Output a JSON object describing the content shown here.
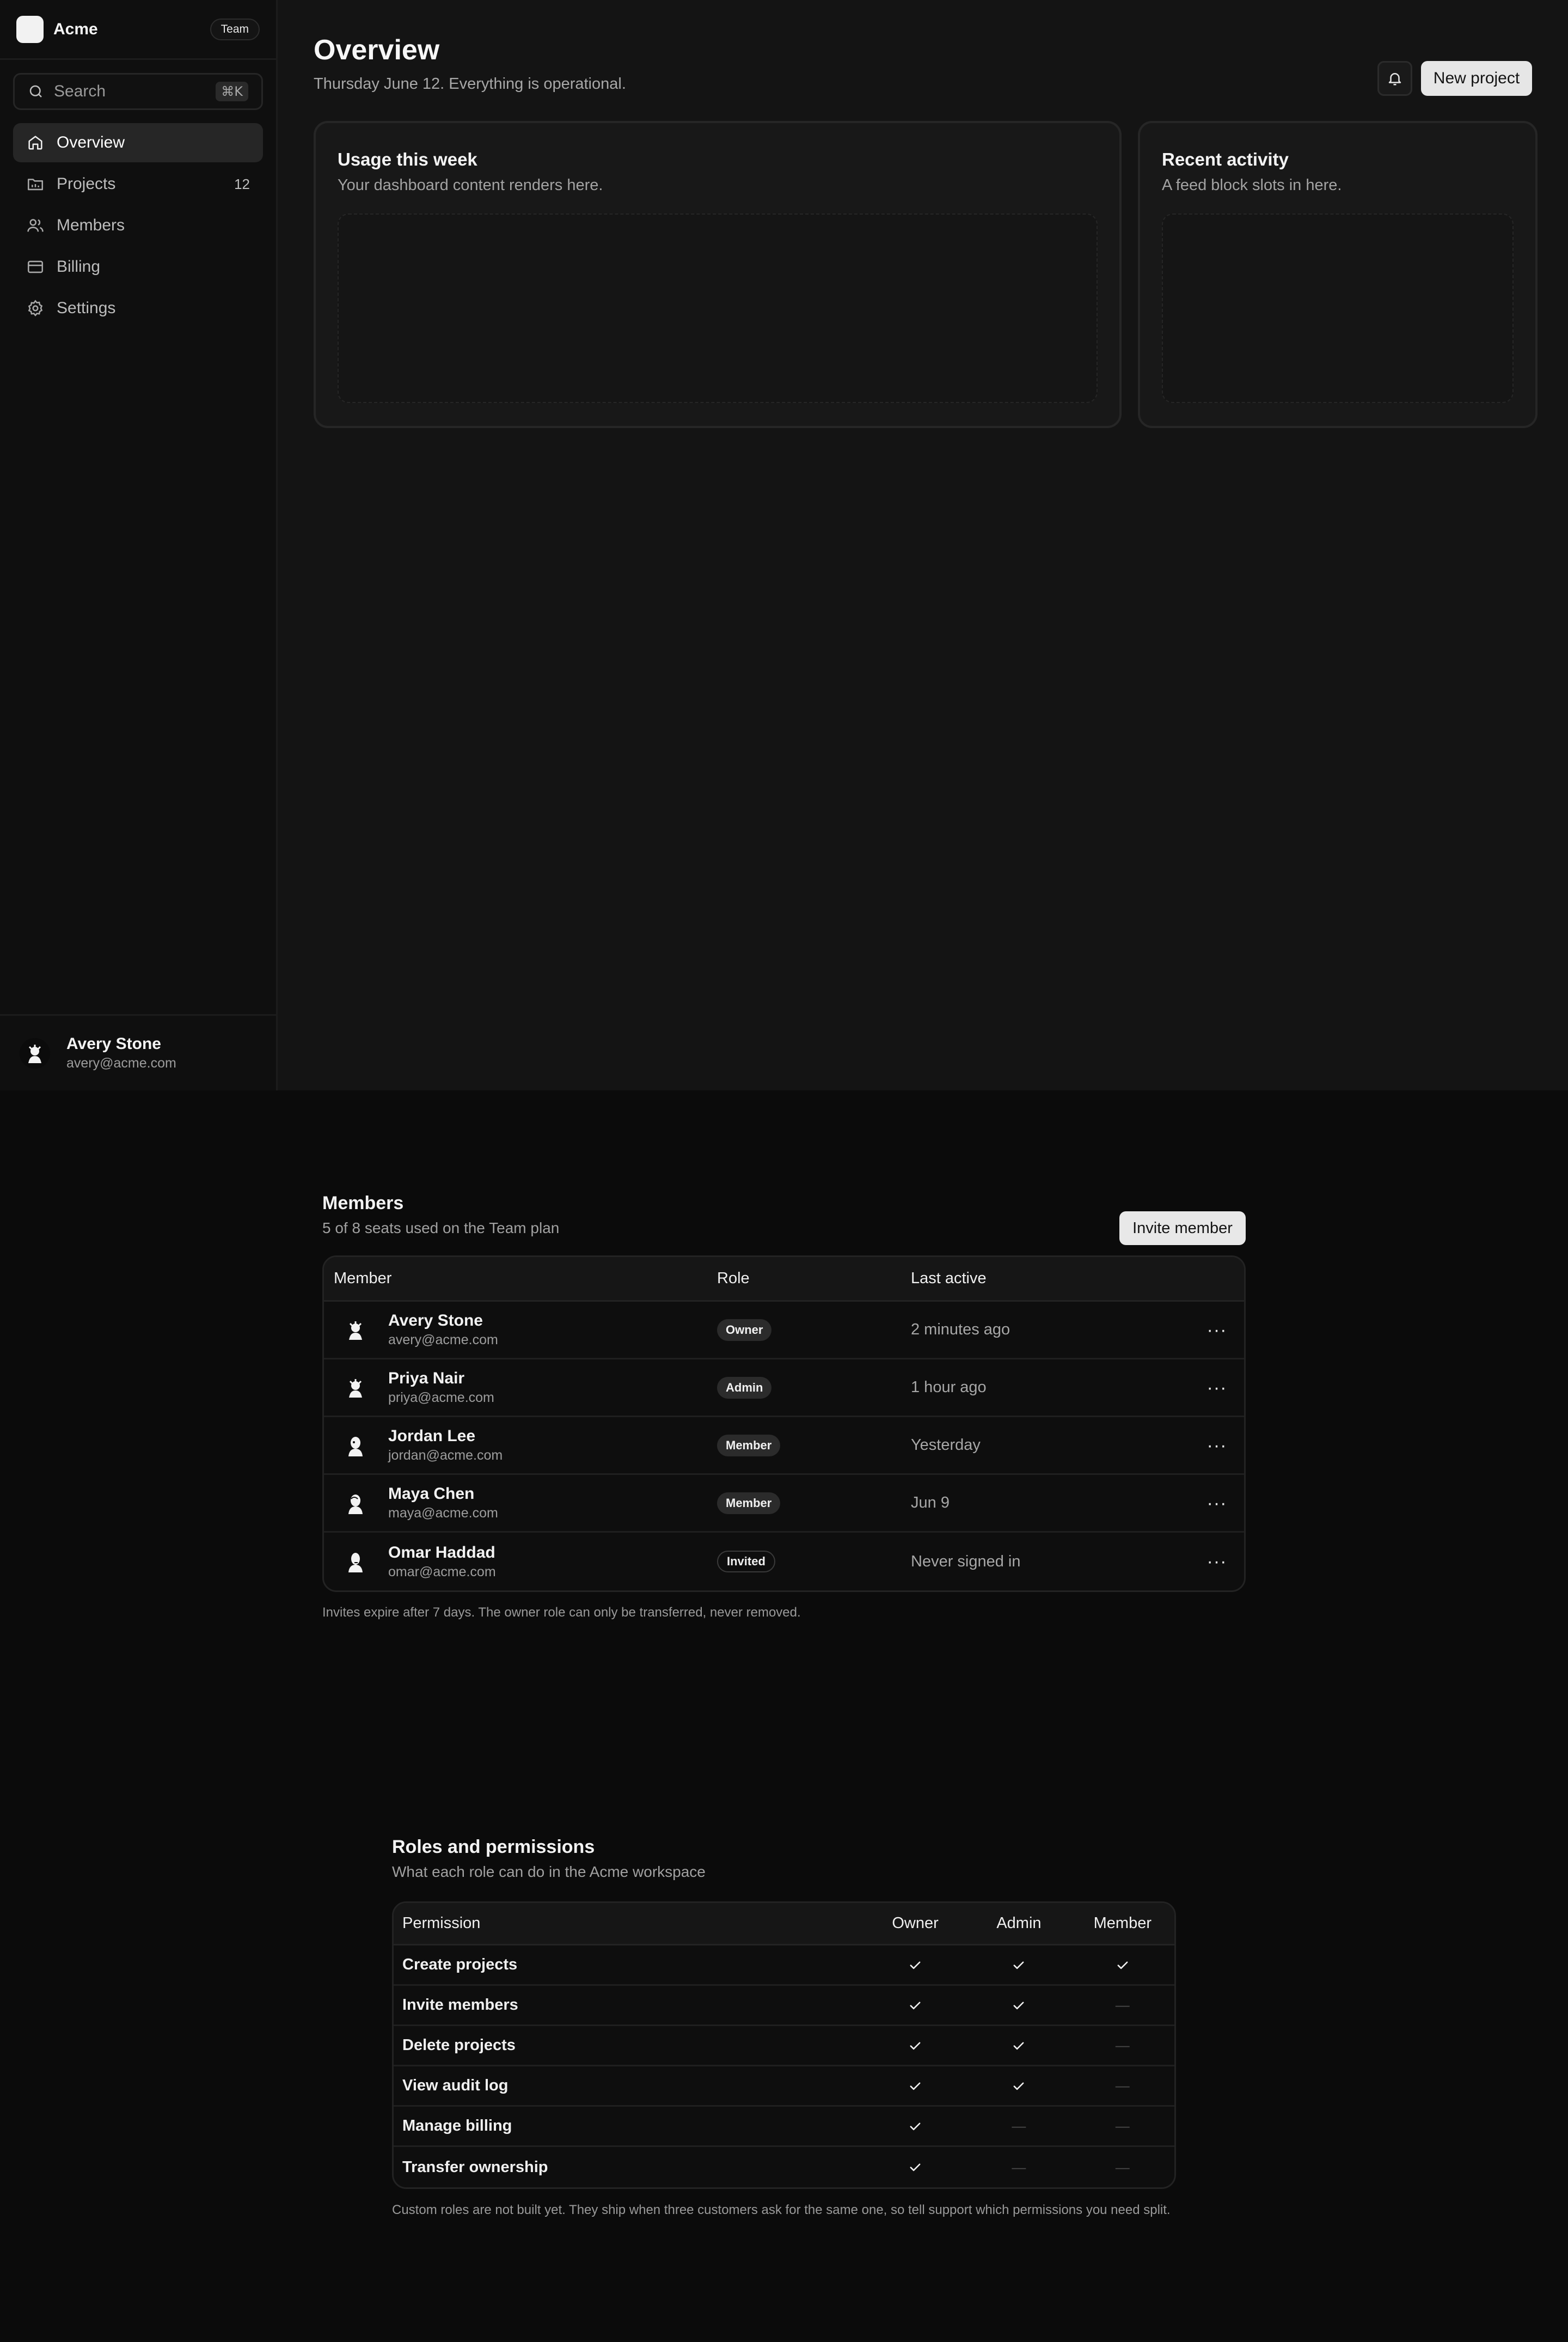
{
  "app": {
    "name": "Acme",
    "plan_badge": "Team"
  },
  "search": {
    "label": "Search",
    "shortcut": "⌘K"
  },
  "nav": [
    {
      "label": "Overview",
      "icon": "home-icon",
      "active": true
    },
    {
      "label": "Projects",
      "icon": "folder-icon",
      "count": "12"
    },
    {
      "label": "Members",
      "icon": "users-icon"
    },
    {
      "label": "Billing",
      "icon": "credit-card-icon"
    },
    {
      "label": "Settings",
      "icon": "gear-icon"
    }
  ],
  "user": {
    "name": "Avery Stone",
    "email": "avery@acme.com"
  },
  "header": {
    "title": "Overview",
    "subtitle": "Thursday June 12. Everything is operational.",
    "new_project": "New project"
  },
  "cards": [
    {
      "title": "Usage this week",
      "subtitle": "Your dashboard content renders here."
    },
    {
      "title": "Recent activity",
      "subtitle": "A feed block slots in here."
    }
  ],
  "members": {
    "title": "Members",
    "subtitle": "5 of 8 seats used on the Team plan",
    "invite_label": "Invite member",
    "columns": [
      "Member",
      "Role",
      "Last active"
    ],
    "rows": [
      {
        "name": "Avery Stone",
        "email": "avery@acme.com",
        "role": "Owner",
        "last_active": "2 minutes ago"
      },
      {
        "name": "Priya Nair",
        "email": "priya@acme.com",
        "role": "Admin",
        "last_active": "1 hour ago"
      },
      {
        "name": "Jordan Lee",
        "email": "jordan@acme.com",
        "role": "Member",
        "last_active": "Yesterday"
      },
      {
        "name": "Maya Chen",
        "email": "maya@acme.com",
        "role": "Member",
        "last_active": "Jun 9"
      },
      {
        "name": "Omar Haddad",
        "email": "omar@acme.com",
        "role": "Invited",
        "last_active": "Never signed in"
      }
    ],
    "footnote": "Invites expire after 7 days. The owner role can only be transferred, never removed."
  },
  "permissions": {
    "title": "Roles and permissions",
    "subtitle": "What each role can do in the Acme workspace",
    "columns": [
      "Permission",
      "Owner",
      "Admin",
      "Member"
    ],
    "rows": [
      {
        "name": "Create projects",
        "owner": true,
        "admin": true,
        "member": true
      },
      {
        "name": "Invite members",
        "owner": true,
        "admin": true,
        "member": false
      },
      {
        "name": "Delete projects",
        "owner": true,
        "admin": true,
        "member": false
      },
      {
        "name": "View audit log",
        "owner": true,
        "admin": true,
        "member": false
      },
      {
        "name": "Manage billing",
        "owner": true,
        "admin": false,
        "member": false
      },
      {
        "name": "Transfer ownership",
        "owner": true,
        "admin": false,
        "member": false
      }
    ],
    "note": "Custom roles are not built yet. They ship when three customers ask for the same one, so tell support which permissions you need split."
  },
  "colors": {
    "background": "#0b0b0b",
    "sidebar": "#0f0f0f",
    "main": "#141414",
    "primary_button": "#e6e6e6"
  }
}
